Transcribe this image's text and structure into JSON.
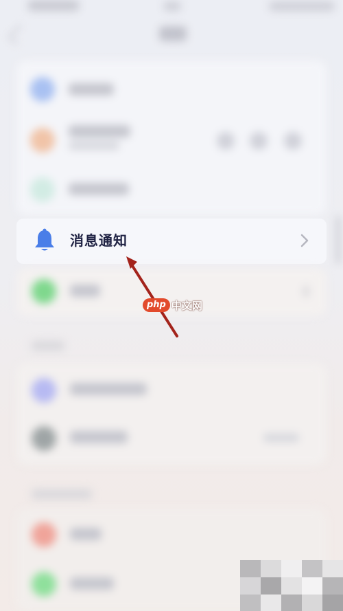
{
  "settings": {
    "focused_item": {
      "label": "消息通知",
      "icon": "bell-icon"
    }
  },
  "watermark": {
    "badge": "php",
    "text": "中文网"
  },
  "colors": {
    "bell": "#4a7ee8",
    "label": "#1f2243",
    "arrow": "#a3231b",
    "watermark_badge": "#e24a2c"
  }
}
